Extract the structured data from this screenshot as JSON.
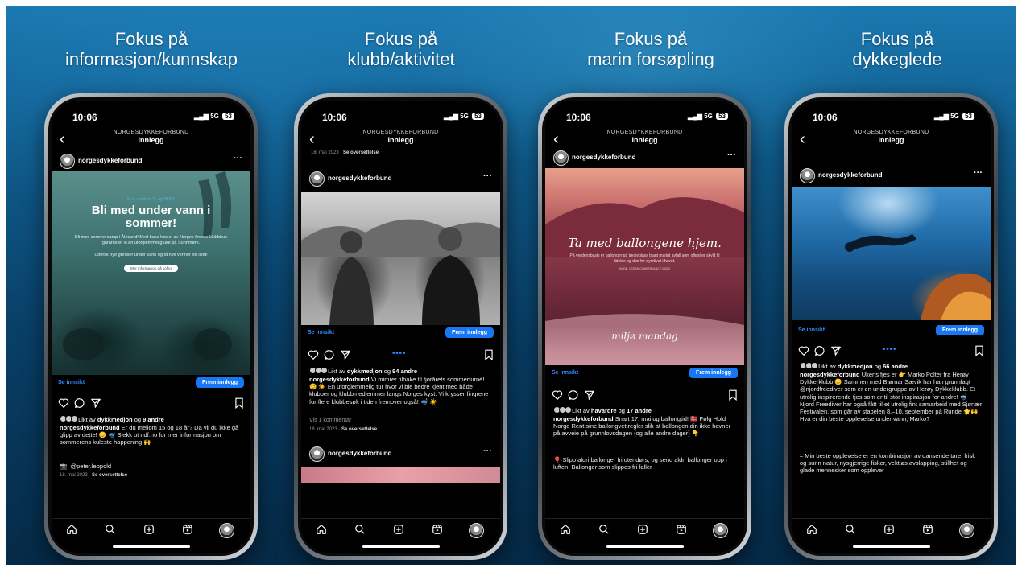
{
  "headings": [
    [
      "Fokus på",
      "informasjon/kunnskap"
    ],
    [
      "Fokus på",
      "klubb/aktivitet"
    ],
    [
      "Fokus på",
      "marin forsøpling"
    ],
    [
      "Fokus på",
      "dykkeglede"
    ]
  ],
  "common": {
    "time": "10:06",
    "signal": "5G",
    "battery": "53",
    "account_caps": "NORGESDYKKEFORBUND",
    "title": "Innlegg",
    "username": "norgesdykkeforbund",
    "more": "···",
    "insight": "Se innsikt",
    "boost": "Frem innlegg",
    "back": "‹"
  },
  "phone1": {
    "overlay_small": "Er du mellom 15 og 18 år?",
    "overlay_title": "Bli med under vann i sommer!",
    "overlay_body": "Bli med sommercamp i Ålesund! Med base hos et av Norges fineste klubbhus garanterer vi en uforglemmelig uke på Sunnmøre.",
    "overlay_body2": "Utforsk nye grenser under vann og få nye venner for livet!",
    "overlay_btn": "Mer informasjon på sofno",
    "liked_by": "dykkmedjon",
    "liked_others": "9 andre",
    "caption": "Er du mellom 15 og 18 år? Da vil du ikke gå glipp av dette! 😊 🤿 Sjekk ut ndf.no for mer informasjon om sommerens kuleste happening 🙌",
    "credit": "📸: @peter.leopold",
    "date": "18. mai 2023",
    "translate": "Se oversettelse"
  },
  "phone2": {
    "date_top": "18. mai 2023",
    "translate_top": "Se oversettelse",
    "liked_by": "dykkmedjon",
    "liked_others": "94 andre",
    "caption": "Vi mimrer tilbake til fjorårets sommerturné! 😊 ☀️ En uforglemmelig tur hvor vi ble bedre kjent med både klubber og klubbmedlemmer langs Norges kyst. Vi krysser fingrene for flere klubbesøk i tiden fremover også! 🤿 ☀️",
    "comments": "Vis 1 kommentar",
    "date": "18. mai 2023",
    "translate": "Se oversettelse"
  },
  "phone3": {
    "image_title": "Ta med ballongene hjem.",
    "image_body": "På verdensbasis er ballonger på tredjeplass blant marint avfall som oftest er skyld til lidelse og død for dyrelivet i havet.",
    "image_source": "KILDE: OCEAN CONSERVANCY (2020)",
    "logo": "miljø mandag",
    "liked_by": "havardre",
    "liked_others": "17 andre",
    "caption": "Snart 17. mai og ballongtid! 🇳🇴 Følg Hold Norge Rent sine ballongvettregler slik at ballongen din ikke havner på avveie på grunnlovsdagen (og alle andre dager) 👇",
    "caption2": "🎈 Slipp aldri ballonger fri utendørs, og send aldri ballonger opp i luften. Ballonger som slippes fri faller"
  },
  "phone4": {
    "liked_by": "dykkmedjon",
    "liked_others": "66 andre",
    "caption": "Ukens fjes er 👉 Marko Polter fra Herøy Dykkerklubb 😊 Sammen med Bjørnar Sævik har han grunnlagt @njordfreediver som er en undergruppe av Herøy Dykkeklubb. Et utrolig inspirerende fjes som er til stor inspirasjon for andre! 🤿 Njord Freediver har også fått til et utrolig fint samarbeid med Sjønær Festivalen, som går av stabelen 8.–10. september på Runde 🌟🙌 Hva er din beste opplevelse under vann, Marko?",
    "caption2": "– Min beste opplevelse er en kombinasjon av dansende tare, frisk og sunn natur, nysgjerrige fisker, vektløs avslapping, stillhet og glade mennesker som opplever"
  }
}
